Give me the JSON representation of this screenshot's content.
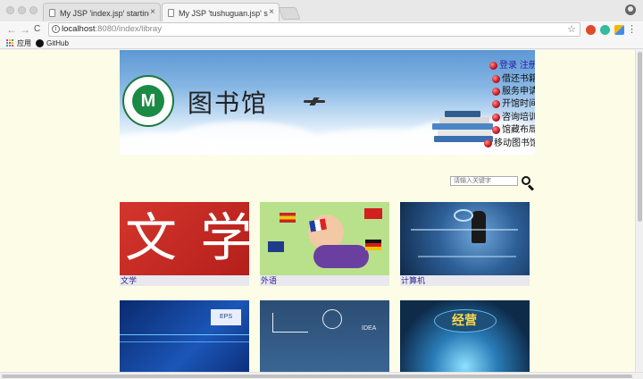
{
  "browser": {
    "tabs": [
      {
        "title": "My JSP 'index.jsp' starting pag",
        "close": "×",
        "active": false
      },
      {
        "title": "My JSP 'tushuguan.jsp' startin",
        "close": "×",
        "active": true
      }
    ],
    "nav": {
      "back": "←",
      "forward": "→",
      "reload": "C"
    },
    "url": {
      "host": "localhost",
      "rest": ":8080/index/libray"
    },
    "bookmarks": [
      {
        "label": "应用",
        "icon": "apps-grid-icon"
      },
      {
        "label": "GitHub",
        "icon": "github-icon"
      }
    ],
    "menu": "⋮"
  },
  "banner": {
    "title": "图书馆",
    "logo_char": "M",
    "menu": {
      "login": "登录",
      "register": "注册",
      "items": [
        "借还书籍",
        "服务申请",
        "开馆时间",
        "咨询培训",
        "馆藏布局",
        "移动图书馆"
      ]
    }
  },
  "search": {
    "placeholder": "请输入关键字"
  },
  "categories": [
    {
      "label": "文学",
      "glyphs": "文 学"
    },
    {
      "label": "外语"
    },
    {
      "label": "计算机"
    },
    {
      "label": "",
      "badge": "EPS"
    },
    {
      "label": "",
      "badge": "IDEA"
    },
    {
      "label": "",
      "badge": "经营"
    }
  ],
  "colors": {
    "page_bg": "#fdfde7",
    "caption_text": "#2a1f90",
    "logo_green": "#1b8a45",
    "bullet_red": "#c0141c"
  }
}
